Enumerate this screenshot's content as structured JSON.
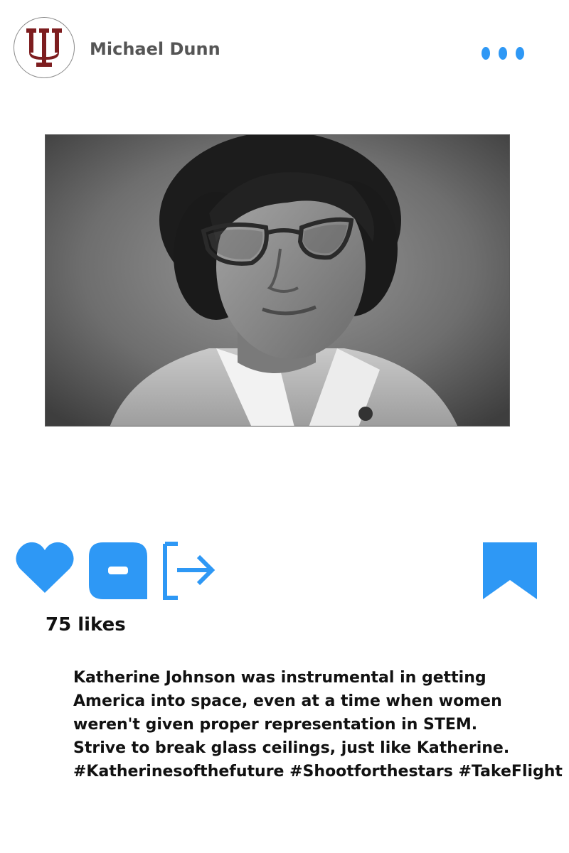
{
  "post": {
    "author": {
      "name": "Michael Dunn",
      "avatar_icon": "indiana-university-trident-logo",
      "avatar_color": "#7d1d1f"
    },
    "more_icon": "more-dots-icon",
    "photo": {
      "subject": "black-and-white portrait photo"
    },
    "actions": {
      "accent_color": "#2e98f5",
      "like_icon": "heart-icon",
      "comment_icon": "comment-icon",
      "share_icon": "share-icon",
      "save_icon": "bookmark-icon"
    },
    "likes_text": "75 likes",
    "caption_lines": [
      "Katherine Johnson was instrumental in getting",
      "America into space, even at a time when women",
      "weren't given proper representation in STEM.",
      "Strive to break glass ceilings, just like Katherine.",
      "#Katherinesofthefuture #Shootforthestars #TakeFlight"
    ]
  }
}
